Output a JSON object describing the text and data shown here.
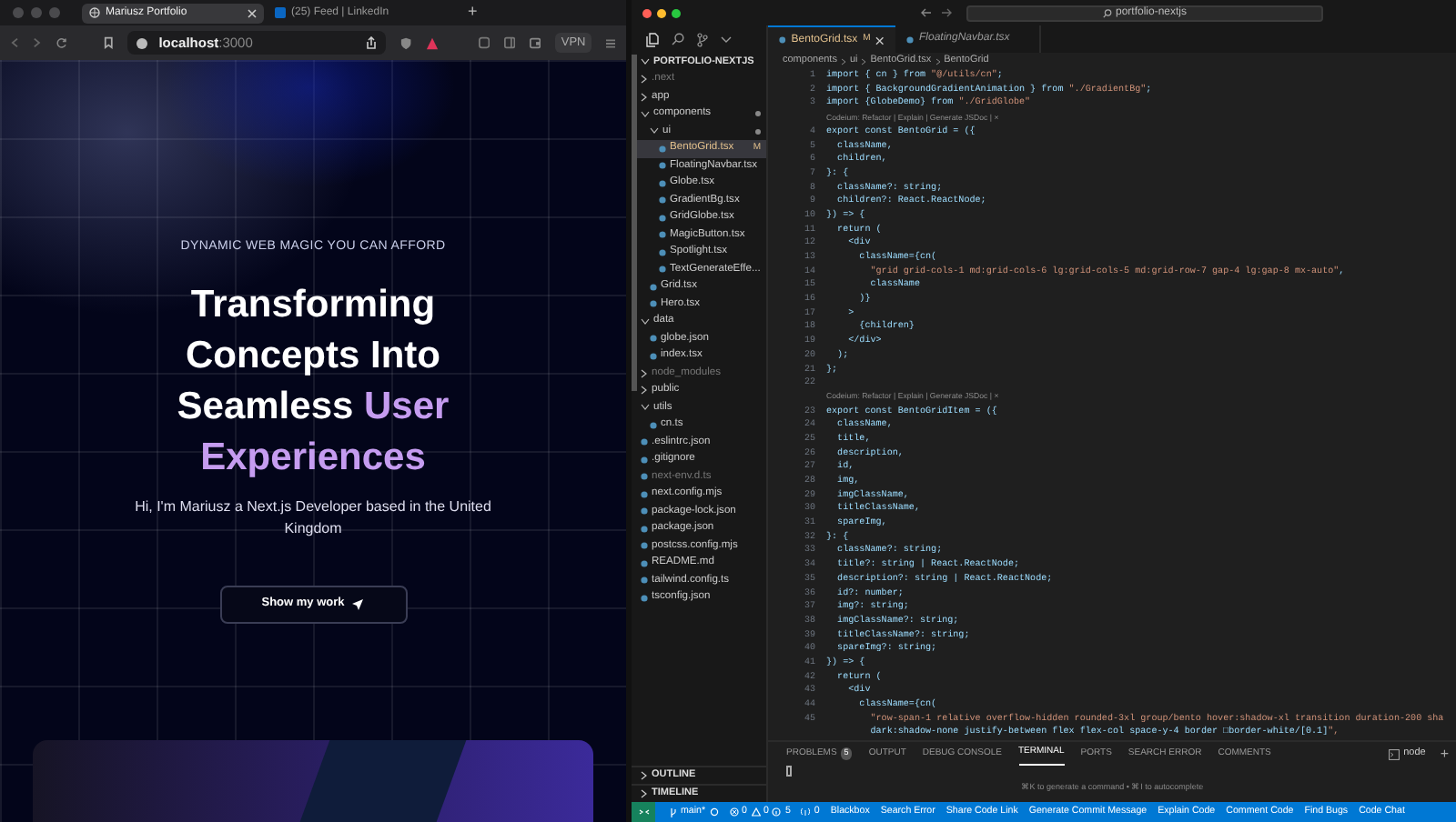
{
  "browser": {
    "tabs": [
      {
        "title": "Mariusz Portfolio",
        "selected": true
      },
      {
        "title": "(25) Feed | LinkedIn",
        "selected": false
      }
    ],
    "new_tab": "+",
    "address": {
      "host": "localhost",
      "port": ":3000"
    },
    "vpn": "VPN"
  },
  "page": {
    "eyebrow": "DYNAMIC WEB MAGIC YOU CAN AFFORD",
    "headline": "Transforming Concepts Into Seamless",
    "highlight": "User Experiences",
    "subtitle": "Hi, I'm Mariusz a Next.js Developer based in the United Kingdom",
    "cta": "Show my work"
  },
  "editor": {
    "search": "portfolio-nextjs",
    "tabs": [
      {
        "label": "BentoGrid.tsx",
        "badge": "M",
        "selected": true
      },
      {
        "label": "FloatingNavbar.tsx",
        "selected": false
      }
    ],
    "breadcrumb": [
      "components",
      "ui",
      "BentoGrid.tsx",
      "BentoGrid"
    ],
    "explorer": {
      "title": "PORTFOLIO-NEXTJS",
      "tree": [
        {
          "label": ".next",
          "kind": "folder",
          "expanded": false,
          "dimmed": true,
          "selected": false
        },
        {
          "label": "app",
          "kind": "folder",
          "expanded": false,
          "dimmed": false,
          "selected": false
        },
        {
          "label": "components",
          "kind": "folder",
          "expanded": true,
          "modified": true,
          "dimmed": false,
          "selected": false,
          "children": [
            {
              "label": "ui",
              "kind": "folder",
              "expanded": true,
              "modified": true,
              "dimmed": false,
              "selected": false,
              "children": [
                {
                  "label": "BentoGrid.tsx",
                  "kind": "file",
                  "badge": "M",
                  "dimmed": false,
                  "selected": true
                },
                {
                  "label": "FloatingNavbar.tsx",
                  "kind": "file",
                  "dimmed": false,
                  "selected": false
                },
                {
                  "label": "Globe.tsx",
                  "kind": "file",
                  "dimmed": false,
                  "selected": false
                },
                {
                  "label": "GradientBg.tsx",
                  "kind": "file",
                  "dimmed": false,
                  "selected": false
                },
                {
                  "label": "GridGlobe.tsx",
                  "kind": "file",
                  "dimmed": false,
                  "selected": false
                },
                {
                  "label": "MagicButton.tsx",
                  "kind": "file",
                  "dimmed": false,
                  "selected": false
                },
                {
                  "label": "Spotlight.tsx",
                  "kind": "file",
                  "dimmed": false,
                  "selected": false
                },
                {
                  "label": "TextGenerateEffe...",
                  "kind": "file",
                  "dimmed": false,
                  "selected": false
                }
              ]
            },
            {
              "label": "Grid.tsx",
              "kind": "file",
              "dimmed": false,
              "selected": false
            },
            {
              "label": "Hero.tsx",
              "kind": "file",
              "dimmed": false,
              "selected": false
            }
          ]
        },
        {
          "label": "data",
          "kind": "folder",
          "expanded": true,
          "dimmed": false,
          "selected": false,
          "children": [
            {
              "label": "globe.json",
              "kind": "file",
              "dimmed": false,
              "selected": false
            },
            {
              "label": "index.tsx",
              "kind": "file",
              "dimmed": false,
              "selected": false
            }
          ]
        },
        {
          "label": "node_modules",
          "kind": "folder",
          "expanded": false,
          "dimmed": true,
          "selected": false
        },
        {
          "label": "public",
          "kind": "folder",
          "expanded": false,
          "dimmed": false,
          "selected": false
        },
        {
          "label": "utils",
          "kind": "folder",
          "expanded": true,
          "dimmed": false,
          "selected": false,
          "children": [
            {
              "label": "cn.ts",
              "kind": "file",
              "dimmed": false,
              "selected": false
            }
          ]
        },
        {
          "label": ".eslintrc.json",
          "kind": "file",
          "dimmed": false,
          "selected": false
        },
        {
          "label": ".gitignore",
          "kind": "file",
          "dimmed": false,
          "selected": false
        },
        {
          "label": "next-env.d.ts",
          "kind": "file",
          "dimmed": true,
          "selected": false
        },
        {
          "label": "next.config.mjs",
          "kind": "file",
          "dimmed": false,
          "selected": false
        },
        {
          "label": "package-lock.json",
          "kind": "file",
          "dimmed": false,
          "selected": false
        },
        {
          "label": "package.json",
          "kind": "file",
          "dimmed": false,
          "selected": false
        },
        {
          "label": "postcss.config.mjs",
          "kind": "file",
          "dimmed": false,
          "selected": false
        },
        {
          "label": "README.md",
          "kind": "file",
          "dimmed": false,
          "selected": false
        },
        {
          "label": "tailwind.config.ts",
          "kind": "file",
          "dimmed": false,
          "selected": false
        },
        {
          "label": "tsconfig.json",
          "kind": "file",
          "dimmed": false,
          "selected": false
        }
      ]
    },
    "lines": [
      {
        "kind": "code",
        "n": "1",
        "code": "import { cn } from \"@/utils/cn\";"
      },
      {
        "kind": "code",
        "n": "2",
        "code": "import { BackgroundGradientAnimation } from \"./GradientBg\";"
      },
      {
        "kind": "code",
        "n": "3",
        "code": "import {GlobeDemo} from \"./GridGlobe\""
      },
      {
        "kind": "lens",
        "code": "Codeium: Refactor | Explain | Generate JSDoc | ×"
      },
      {
        "kind": "code",
        "n": "4",
        "code": "export const BentoGrid = ({"
      },
      {
        "kind": "code",
        "n": "5",
        "code": "  className,"
      },
      {
        "kind": "code",
        "n": "6",
        "code": "  children,"
      },
      {
        "kind": "code",
        "n": "7",
        "code": "}: {"
      },
      {
        "kind": "code",
        "n": "8",
        "code": "  className?: string;"
      },
      {
        "kind": "code",
        "n": "9",
        "code": "  children?: React.ReactNode;"
      },
      {
        "kind": "code",
        "n": "10",
        "code": "}) => {"
      },
      {
        "kind": "code",
        "n": "11",
        "code": "  return ("
      },
      {
        "kind": "code",
        "n": "12",
        "code": "    <div"
      },
      {
        "kind": "code",
        "n": "13",
        "code": "      className={cn("
      },
      {
        "kind": "code",
        "n": "14",
        "code": "        \"grid grid-cols-1 md:grid-cols-6 lg:grid-cols-5 md:grid-row-7 gap-4 lg:gap-8 mx-auto\","
      },
      {
        "kind": "code",
        "n": "15",
        "code": "        className"
      },
      {
        "kind": "code",
        "n": "16",
        "code": "      )}"
      },
      {
        "kind": "code",
        "n": "17",
        "code": "    >"
      },
      {
        "kind": "code",
        "n": "18",
        "code": "      {children}"
      },
      {
        "kind": "code",
        "n": "19",
        "code": "    </div>"
      },
      {
        "kind": "code",
        "n": "20",
        "code": "  );"
      },
      {
        "kind": "code",
        "n": "21",
        "code": "};"
      },
      {
        "kind": "code",
        "n": "22"
      },
      {
        "kind": "lens",
        "code": "Codeium: Refactor | Explain | Generate JSDoc | ×"
      },
      {
        "kind": "code",
        "n": "23",
        "code": "export const BentoGridItem = ({"
      },
      {
        "kind": "code",
        "n": "24",
        "code": "  className,"
      },
      {
        "kind": "code",
        "n": "25",
        "code": "  title,"
      },
      {
        "kind": "code",
        "n": "26",
        "code": "  description,"
      },
      {
        "kind": "code",
        "n": "27",
        "code": "  id,"
      },
      {
        "kind": "code",
        "n": "28",
        "code": "  img,"
      },
      {
        "kind": "code",
        "n": "29",
        "code": "  imgClassName,"
      },
      {
        "kind": "code",
        "n": "30",
        "code": "  titleClassName,"
      },
      {
        "kind": "code",
        "n": "31",
        "code": "  spareImg,"
      },
      {
        "kind": "code",
        "n": "32",
        "code": "}: {"
      },
      {
        "kind": "code",
        "n": "33",
        "code": "  className?: string;"
      },
      {
        "kind": "code",
        "n": "34",
        "code": "  title?: string | React.ReactNode;"
      },
      {
        "kind": "code",
        "n": "35",
        "code": "  description?: string | React.ReactNode;"
      },
      {
        "kind": "code",
        "n": "36",
        "code": "  id?: number;"
      },
      {
        "kind": "code",
        "n": "37",
        "code": "  img?: string;"
      },
      {
        "kind": "code",
        "n": "38",
        "code": "  imgClassName?: string;"
      },
      {
        "kind": "code",
        "n": "39",
        "code": "  titleClassName?: string;"
      },
      {
        "kind": "code",
        "n": "40",
        "code": "  spareImg?: string;"
      },
      {
        "kind": "code",
        "n": "41",
        "code": "}) => {"
      },
      {
        "kind": "code",
        "n": "42",
        "code": "  return ("
      },
      {
        "kind": "code",
        "n": "43",
        "code": "    <div"
      },
      {
        "kind": "code",
        "n": "44",
        "code": "      className={cn("
      },
      {
        "kind": "code",
        "n": "45",
        "code": "        \"row-span-1 relative overflow-hidden rounded-3xl group/bento hover:shadow-xl transition duration-200 sha"
      },
      {
        "kind": "wrap",
        "code": "        dark:shadow-none justify-between flex flex-col space-y-4 border □border-white/[0.1]\","
      }
    ],
    "outline": "OUTLINE",
    "timeline": "TIMELINE",
    "panel": {
      "tabs": [
        {
          "label": "PROBLEMS",
          "count": "5",
          "selected": false
        },
        {
          "label": "OUTPUT",
          "selected": false
        },
        {
          "label": "DEBUG CONSOLE",
          "selected": false
        },
        {
          "label": "TERMINAL",
          "selected": true
        },
        {
          "label": "PORTS",
          "selected": false
        },
        {
          "label": "SEARCH ERROR",
          "selected": false
        },
        {
          "label": "COMMENTS",
          "selected": false
        }
      ],
      "shell": "node",
      "new_terminal": "+",
      "hint": "⌘K to generate a command • ⌘I to autocomplete"
    },
    "status_bar": {
      "branch": "main*",
      "errors": "0",
      "warnings": "0",
      "infos": "5",
      "ports": "0",
      "actions": [
        "Blackbox",
        "Search Error",
        "Share Code Link",
        "Generate Commit Message",
        "Explain Code",
        "Comment Code",
        "Find Bugs",
        "Code Chat"
      ]
    }
  }
}
